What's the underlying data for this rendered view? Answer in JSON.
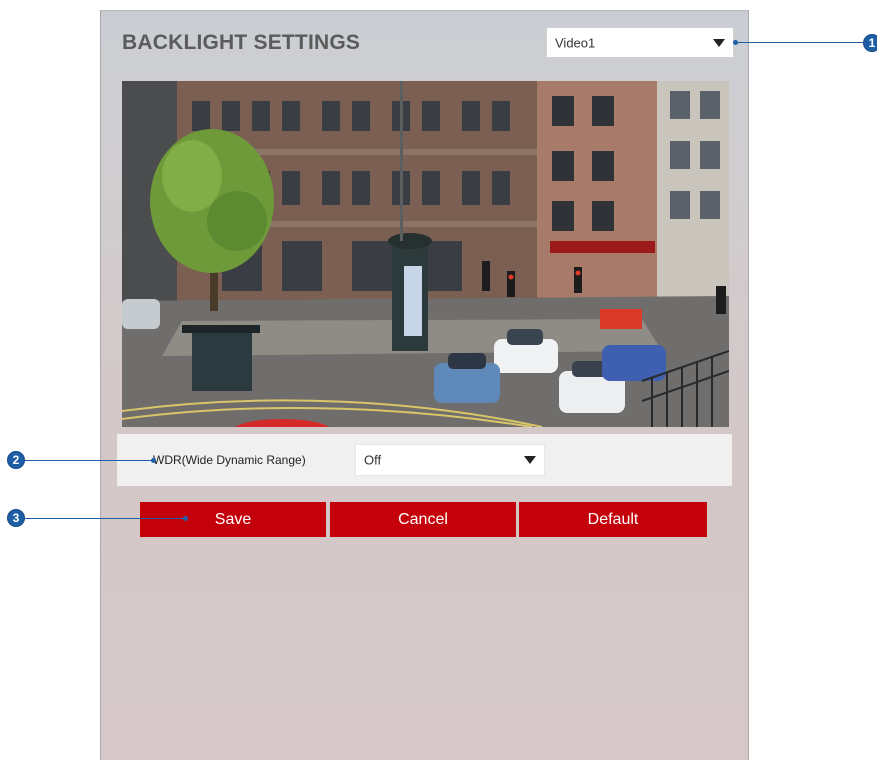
{
  "page": {
    "title": "BACKLIGHT SETTINGS"
  },
  "video_select": {
    "value": "Video1"
  },
  "wdr": {
    "label": "WDR(Wide Dynamic Range)",
    "value": "Off"
  },
  "buttons": {
    "save": "Save",
    "cancel": "Cancel",
    "default": "Default"
  },
  "callouts": {
    "one": "1",
    "two": "2",
    "three": "3"
  },
  "colors": {
    "button": "#c4000b",
    "callout": "#1d5ea7",
    "title": "#5b5b5b"
  },
  "icons": {
    "dropdown": "caret-down-icon"
  }
}
